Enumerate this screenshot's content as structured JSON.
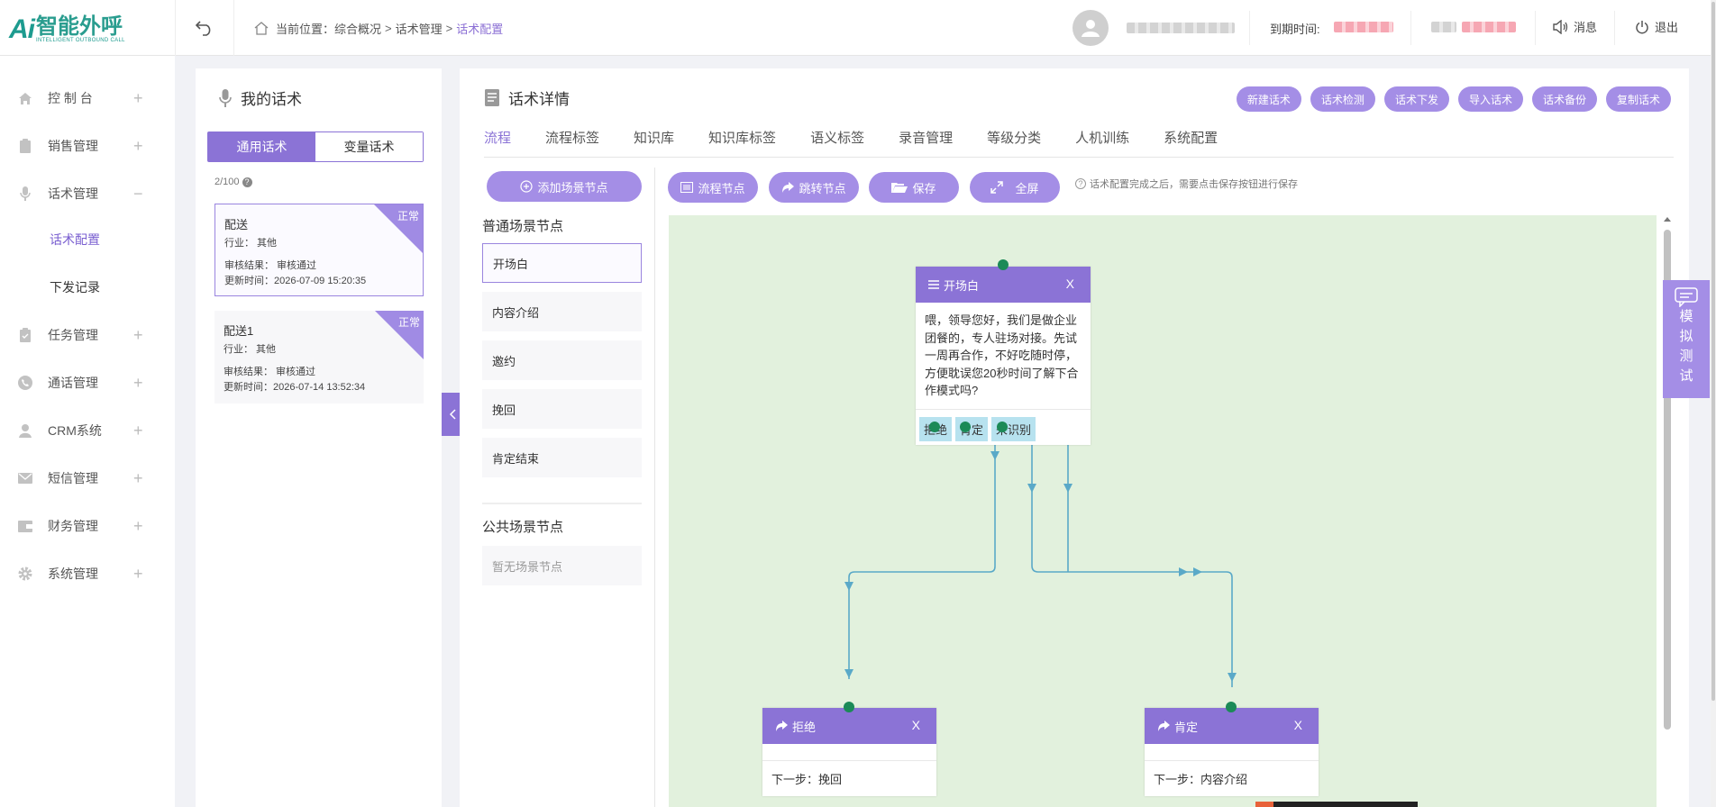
{
  "header": {
    "logo_ai": "Ai",
    "logo_main": "智能外呼",
    "logo_sub": "INTELLIGENT OUTBOUND CALL",
    "breadcrumb": {
      "label": "当前位置：",
      "items": [
        "综合概况",
        "话术管理",
        "话术配置"
      ],
      "sep": ">"
    },
    "expiry_label": "到期时间:",
    "message_label": "消息",
    "logout_label": "退出"
  },
  "sidebar": {
    "items": [
      {
        "label": "控 制 台",
        "icon": "home-icon",
        "toggle": "+"
      },
      {
        "label": "销售管理",
        "icon": "clipboard-icon",
        "toggle": "+"
      },
      {
        "label": "话术管理",
        "icon": "microphone-icon",
        "toggle": "−"
      },
      {
        "label": "任务管理",
        "icon": "clipboard-check-icon",
        "toggle": "+"
      },
      {
        "label": "通话管理",
        "icon": "phone-icon",
        "toggle": "+"
      },
      {
        "label": "CRM系统",
        "icon": "user-icon",
        "toggle": "+"
      },
      {
        "label": "短信管理",
        "icon": "mail-icon",
        "toggle": "+"
      },
      {
        "label": "财务管理",
        "icon": "wallet-icon",
        "toggle": "+"
      },
      {
        "label": "系统管理",
        "icon": "gear-icon",
        "toggle": "+"
      }
    ],
    "subitems": [
      {
        "label": "话术配置",
        "active": true
      },
      {
        "label": "下发记录",
        "active": false
      }
    ]
  },
  "scripts_panel": {
    "title": "我的话术",
    "tabs": [
      "通用话术",
      "变量话术"
    ],
    "count": "2/100",
    "cards": [
      {
        "name": "配送",
        "industry": "行业：  其他",
        "review": "审核结果：  审核通过",
        "updated": "更新时间：2026-07-09 15:20:35",
        "status": "正常"
      },
      {
        "name": "配送1",
        "industry": "行业：  其他",
        "review": "审核结果：  审核通过",
        "updated": "更新时间：2026-07-14 13:52:34",
        "status": "正常"
      }
    ]
  },
  "detail": {
    "title": "话术详情",
    "actions": [
      "新建话术",
      "话术检测",
      "话术下发",
      "导入话术",
      "话术备份",
      "复制话术"
    ],
    "tabs": [
      "流程",
      "流程标签",
      "知识库",
      "知识库标签",
      "语义标签",
      "录音管理",
      "等级分类",
      "人机训练",
      "系统配置"
    ],
    "add_scene": "添加场景节点",
    "common_section": "普通场景节点",
    "common_nodes": [
      "开场白",
      "内容介绍",
      "邀约",
      "挽回",
      "肯定结束"
    ],
    "public_section": "公共场景节点",
    "public_empty": "暂无场景节点",
    "toolbar": [
      "流程节点",
      "跳转节点",
      "保存",
      "全屏"
    ],
    "hint": "话术配置完成之后，需要点击保存按钮进行保存"
  },
  "flow": {
    "start": {
      "title": "开场白",
      "close": "X",
      "text": "喂，领导您好，我们是做企业团餐的，专人驻场对接。先试一周再合作，不好吃随时停，方便耽误您20秒时间了解下合作模式吗?",
      "options": [
        "拒绝",
        "肯定",
        "未识别"
      ]
    },
    "jumps": [
      {
        "title": "拒绝",
        "close": "X",
        "next": "下一步：挽回"
      },
      {
        "title": "肯定",
        "close": "X",
        "next": "下一步：内容介绍"
      }
    ]
  },
  "float_test": [
    "模",
    "拟",
    "测",
    "试"
  ],
  "colors": {
    "primary": "#8b73d6",
    "pill": "#a48ee6",
    "canvas": "#e2f1dd",
    "edge": "#5aa9c8",
    "port": "#1b8a57"
  }
}
